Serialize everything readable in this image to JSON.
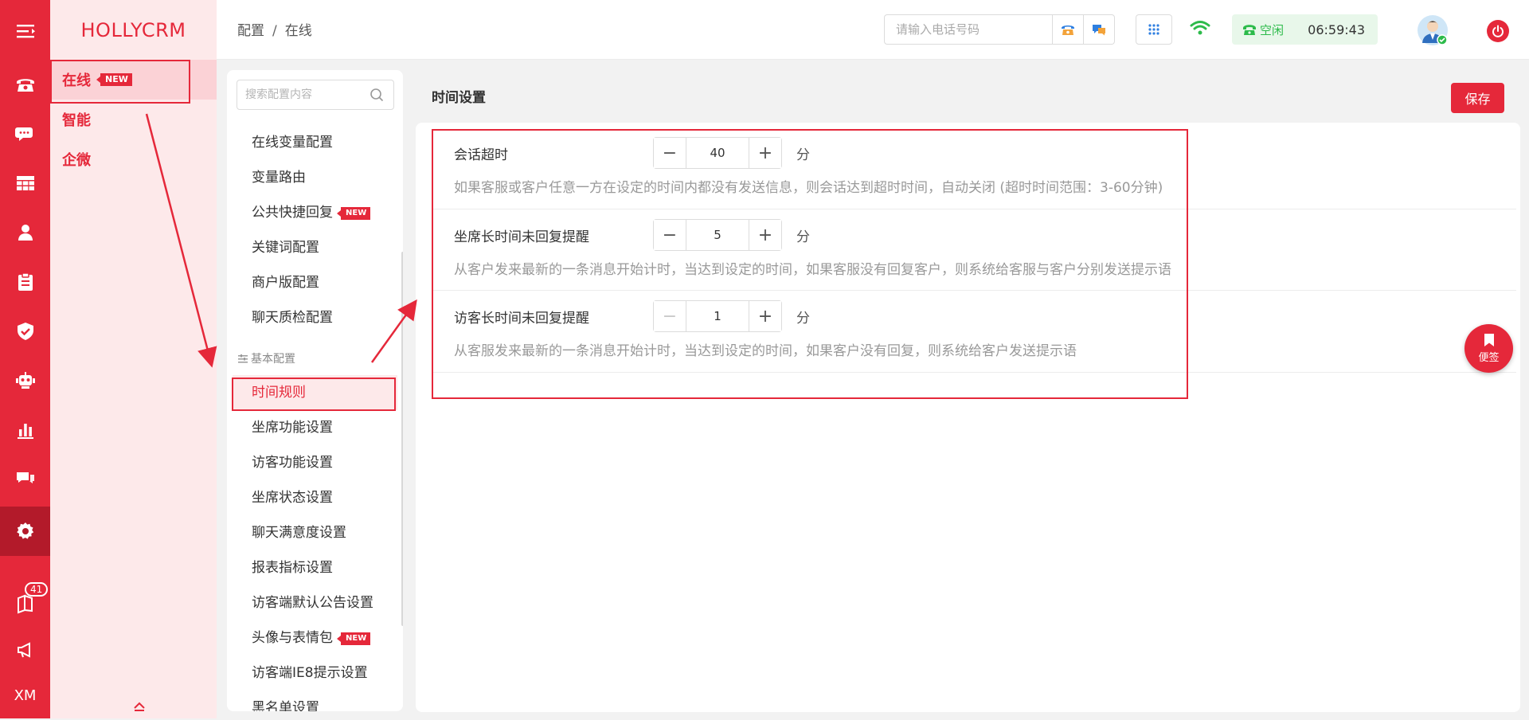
{
  "rail": {
    "badge_count": "41",
    "bottom_label": "XM"
  },
  "brand": "HOLLYCRM",
  "nav2": {
    "items": [
      {
        "label": "在线",
        "tag": "NEW"
      },
      {
        "label": "智能"
      },
      {
        "label": "企微"
      }
    ]
  },
  "header": {
    "breadcrumb": [
      "配置",
      "在线"
    ],
    "breadcrumb_sep": "/",
    "phone_placeholder": "请输入电话号码",
    "status_text": "空闲",
    "status_time": "06:59:43"
  },
  "config": {
    "search_placeholder": "搜索配置内容",
    "items_top": [
      {
        "label": "在线变量配置"
      },
      {
        "label": "变量路由"
      },
      {
        "label": "公共快捷回复",
        "tag": "NEW"
      },
      {
        "label": "关键词配置"
      },
      {
        "label": "商户版配置"
      },
      {
        "label": "聊天质检配置"
      }
    ],
    "group_label": "基本配置",
    "items_basic": [
      {
        "label": "时间规则"
      },
      {
        "label": "坐席功能设置"
      },
      {
        "label": "访客功能设置"
      },
      {
        "label": "坐席状态设置"
      },
      {
        "label": "聊天满意度设置"
      },
      {
        "label": "报表指标设置"
      },
      {
        "label": "访客端默认公告设置"
      },
      {
        "label": "头像与表情包",
        "tag": "NEW"
      },
      {
        "label": "访客端IE8提示设置"
      },
      {
        "label": "黑名单设置"
      }
    ]
  },
  "main": {
    "title": "时间设置",
    "save_label": "保存",
    "rows": [
      {
        "label": "会话超时",
        "value": "40",
        "unit": "分",
        "desc": "如果客服或客户任意一方在设定的时间内都没有发送信息，则会话达到超时时间，自动关闭 (超时时间范围：3-60分钟)"
      },
      {
        "label": "坐席长时间未回复提醒",
        "value": "5",
        "unit": "分",
        "desc": "从客户发来最新的一条消息开始计时，当达到设定的时间，如果客服没有回复客户，则系统给客服与客户分别发送提示语"
      },
      {
        "label": "访客长时间未回复提醒",
        "value": "1",
        "unit": "分",
        "desc": "从客服发来最新的一条消息开始计时，当达到设定的时间，如果客户没有回复，则系统给客户发送提示语"
      }
    ],
    "minus": "−",
    "plus": "+"
  },
  "sticky_label": "便签",
  "colors": {
    "brand_red": "#e5283a",
    "rail_active": "#b31a2a",
    "nav_bg": "#fde9ea",
    "status_green": "#2dbb4b"
  }
}
